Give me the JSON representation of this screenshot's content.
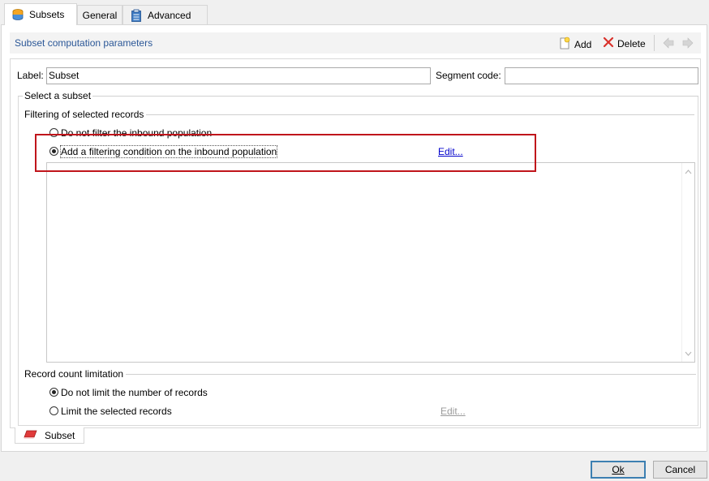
{
  "tabs": [
    {
      "label": "Subsets",
      "icon": "database-icon",
      "active": true
    },
    {
      "label": "General",
      "icon": "",
      "active": false
    },
    {
      "label": "Advanced",
      "icon": "clipboard-icon",
      "active": false
    }
  ],
  "section": {
    "title": "Subset computation parameters",
    "add_label": "Add",
    "delete_label": "Delete"
  },
  "form": {
    "label_caption": "Label:",
    "label_value": "Subset",
    "segment_caption": "Segment code:",
    "segment_value": ""
  },
  "select_group": {
    "title": "Select a subset"
  },
  "filtering": {
    "title": "Filtering of selected records",
    "option_none": "Do not filter the inbound population",
    "option_condition": "Add a filtering condition on the inbound population",
    "edit_label": "Edit...",
    "selected": "condition"
  },
  "count_limit": {
    "title": "Record count limitation",
    "option_none": "Do not limit the number of records",
    "option_limit": "Limit the selected records",
    "edit_label": "Edit...",
    "selected": "none"
  },
  "bottom_tab": {
    "label": "Subset",
    "icon": "eraser-icon"
  },
  "buttons": {
    "ok": "Ok",
    "cancel": "Cancel"
  },
  "colors": {
    "highlight": "#c0151b",
    "accent": "#2b5797",
    "link": "#0000cc"
  }
}
